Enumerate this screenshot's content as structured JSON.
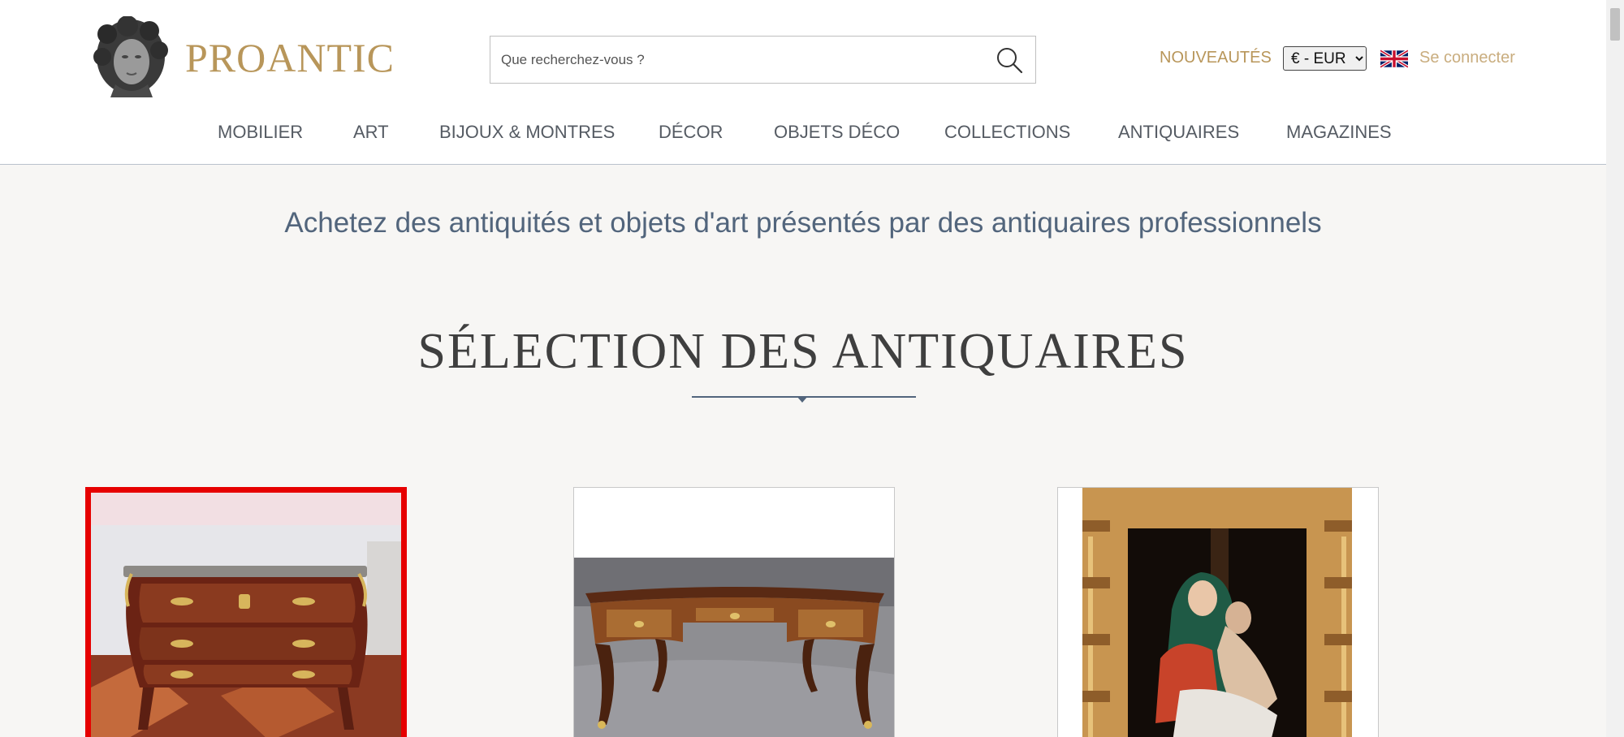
{
  "header": {
    "logo_text": "PROANTIC",
    "search_placeholder": "Que recherchez-vous ?",
    "nouveautes_label": "NOUVEAUTÉS",
    "currency_selected": "€ - EUR",
    "language_flag": "uk-flag-icon",
    "login_label": "Se connecter"
  },
  "nav": {
    "items": [
      "MOBILIER",
      "ART",
      "BIJOUX & MONTRES",
      "DÉCOR",
      "OBJETS DÉCO",
      "COLLECTIONS",
      "ANTIQUAIRES",
      "MAGAZINES"
    ]
  },
  "main": {
    "tagline": "Achetez des antiquités et objets d'art présentés par des antiquaires professionnels",
    "section_title": "SÉLECTION DES ANTIQUAIRES"
  },
  "colors": {
    "brand_gold": "#b8965a",
    "login_gold": "#c9ad7f",
    "heading_blue": "#52657c",
    "selection_red": "#e60000",
    "background": "#f7f6f4"
  }
}
